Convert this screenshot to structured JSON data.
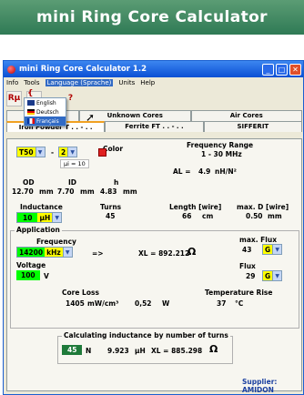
{
  "banner": {
    "title": "mini Ring Core Calculator"
  },
  "window": {
    "title": "mini Ring Core Calculator 1.2",
    "min": "_",
    "max": "□",
    "close": "✕"
  },
  "menu": {
    "items": [
      "Info",
      "Tools",
      "Language (Sprache)",
      "Units",
      "Help"
    ]
  },
  "toolbar": {
    "btn1": "Rμ",
    "btn2": "{ }",
    "btn3": "?"
  },
  "language_menu": {
    "items": [
      "English",
      "Deutsch",
      "Français"
    ],
    "selected": "Français"
  },
  "tabs_top": [
    "Fe…",
    "Unknown Cores",
    "Air Cores"
  ],
  "tabs_bottom": [
    "Iron Powder T . . - . .",
    "Ferrite FT . . - . .",
    "SIFFERIT"
  ],
  "core": {
    "type": "T50",
    "material": "2",
    "mu": "µi = 10",
    "color_label": "Color",
    "color_hex": "#e02020",
    "freq_label": "Frequency Range",
    "freq_value": "1 - 30  MHz",
    "al_label": "AL =",
    "al_value": "4.9",
    "al_unit": "nH/N²",
    "od_label": "OD",
    "id_label": "ID",
    "h_label": "h",
    "od": "12.70",
    "id": "7.70",
    "h": "4.83",
    "mm": "mm"
  },
  "winding": {
    "inductance_label": "Inductance",
    "inductance_value": "10",
    "inductance_unit": "µH",
    "turns_label": "Turns",
    "turns_value": "45",
    "length_label": "Length [wire]",
    "length_value": "66",
    "length_unit": "cm",
    "maxd_label": "max. D [wire]",
    "maxd_value": "0.50",
    "maxd_unit": "mm"
  },
  "application": {
    "legend": "Application",
    "freq_label": "Frequency",
    "freq_value": "14200",
    "freq_unit": "kHz",
    "arrow": "=>",
    "xl_text": "XL = 892.212",
    "omega": "Ω",
    "maxflux_label": "max. Flux",
    "maxflux_value": "43",
    "maxflux_unit": "G",
    "voltage_label": "Voltage",
    "voltage_value": "100",
    "voltage_unit": "V",
    "flux_label": "Flux",
    "flux_value": "29",
    "flux_unit": "G",
    "coreloss_label": "Core Loss",
    "coreloss_value": "1405",
    "coreloss_unit": "mW/cm³",
    "watts_value": "0,52",
    "watts_unit": "W",
    "temp_label": "Temperature Rise",
    "temp_value": "37",
    "temp_unit": "°C"
  },
  "calc": {
    "legend": "Calculating inductance by number of turns",
    "n_value": "45",
    "n_unit": "N",
    "uh_value": "9.923",
    "uh_unit": "µH",
    "xl_text": "XL = 885.298",
    "omega": "Ω"
  },
  "supplier": "Supplier: AMIDON"
}
